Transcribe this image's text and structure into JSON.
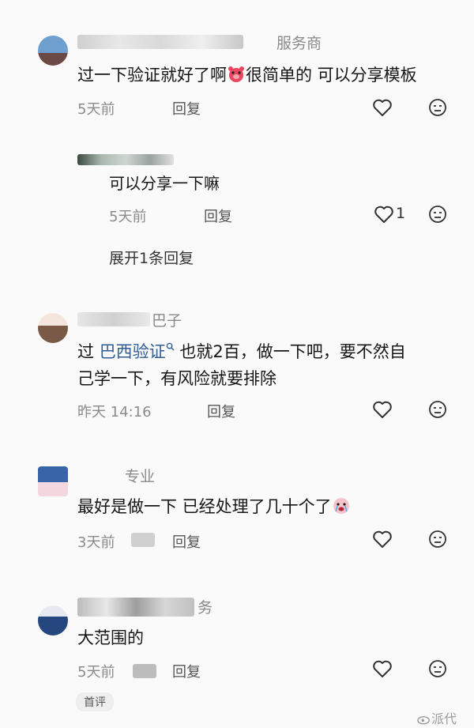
{
  "comments": [
    {
      "username_suffix": "服务商",
      "text_a": "过一下验证就好了啊",
      "text_b": "很简单的 可以分享模板",
      "time": "5天前",
      "reply_label": "回复"
    },
    {
      "text": "可以分享一下嘛",
      "time": "5天前",
      "reply_label": "回复",
      "like_count": "1"
    },
    {
      "username_suffix": "巴子",
      "text_prefix": "过 ",
      "link_text": "巴西验证",
      "text_line1_rest": " 也就2百，做一下吧，要不然自",
      "text_line2": "己学一下，有风险就要排除",
      "time": "昨天 14:16",
      "reply_label": "回复"
    },
    {
      "username_suffix": "专业",
      "text": "最好是做一下 已经处理了几十个了",
      "time": "3天前",
      "reply_label": "回复"
    },
    {
      "username_suffix": "务",
      "text": "大范围的",
      "time": "5天前",
      "reply_label": "回复"
    }
  ],
  "expand_replies": "展开1条回复",
  "first_comment_tag": "首评",
  "watermark": "派代",
  "colors": {
    "link": "#2f5d97",
    "meta": "#8a8a8a",
    "text": "#161616"
  },
  "icons": [
    "heart-outline-icon",
    "dislike-face-icon",
    "search-icon"
  ]
}
